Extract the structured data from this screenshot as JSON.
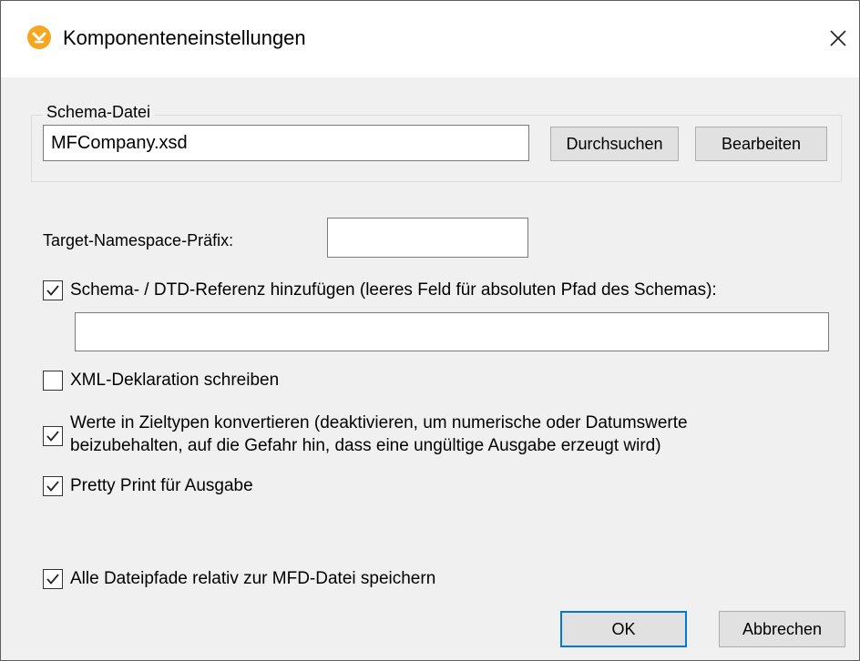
{
  "window": {
    "title": "Komponenteneinstellungen",
    "icon": "mapforce-app-icon",
    "close_icon": "close-icon"
  },
  "schema_group": {
    "legend": "Schema-Datei",
    "file_value": "MFCompany.xsd",
    "browse_label": "Durchsuchen",
    "edit_label": "Bearbeiten"
  },
  "namespace": {
    "label": "Target-Namespace-Präfix:",
    "value": ""
  },
  "options": [
    {
      "label": "Schema- / DTD-Referenz hinzufügen (leeres Feld für absoluten Pfad des Schemas):",
      "checked": true
    },
    {
      "label": "XML-Deklaration schreiben",
      "checked": false
    },
    {
      "label_line1": "Werte in Zieltypen konvertieren (deaktivieren, um numerische oder Datumswerte",
      "label_line2": "beizubehalten, auf die Gefahr hin, dass eine ungültige Ausgabe erzeugt wird)",
      "checked": true
    },
    {
      "label": "Pretty Print für Ausgabe",
      "checked": true
    },
    {
      "label": "Alle Dateipfade relativ zur MFD-Datei speichern",
      "checked": true
    }
  ],
  "schema_reference_value": "",
  "footer": {
    "ok_label": "OK",
    "cancel_label": "Abbrechen"
  },
  "colors": {
    "accent": "#0078d7",
    "icon_orange": "#f5a623"
  }
}
